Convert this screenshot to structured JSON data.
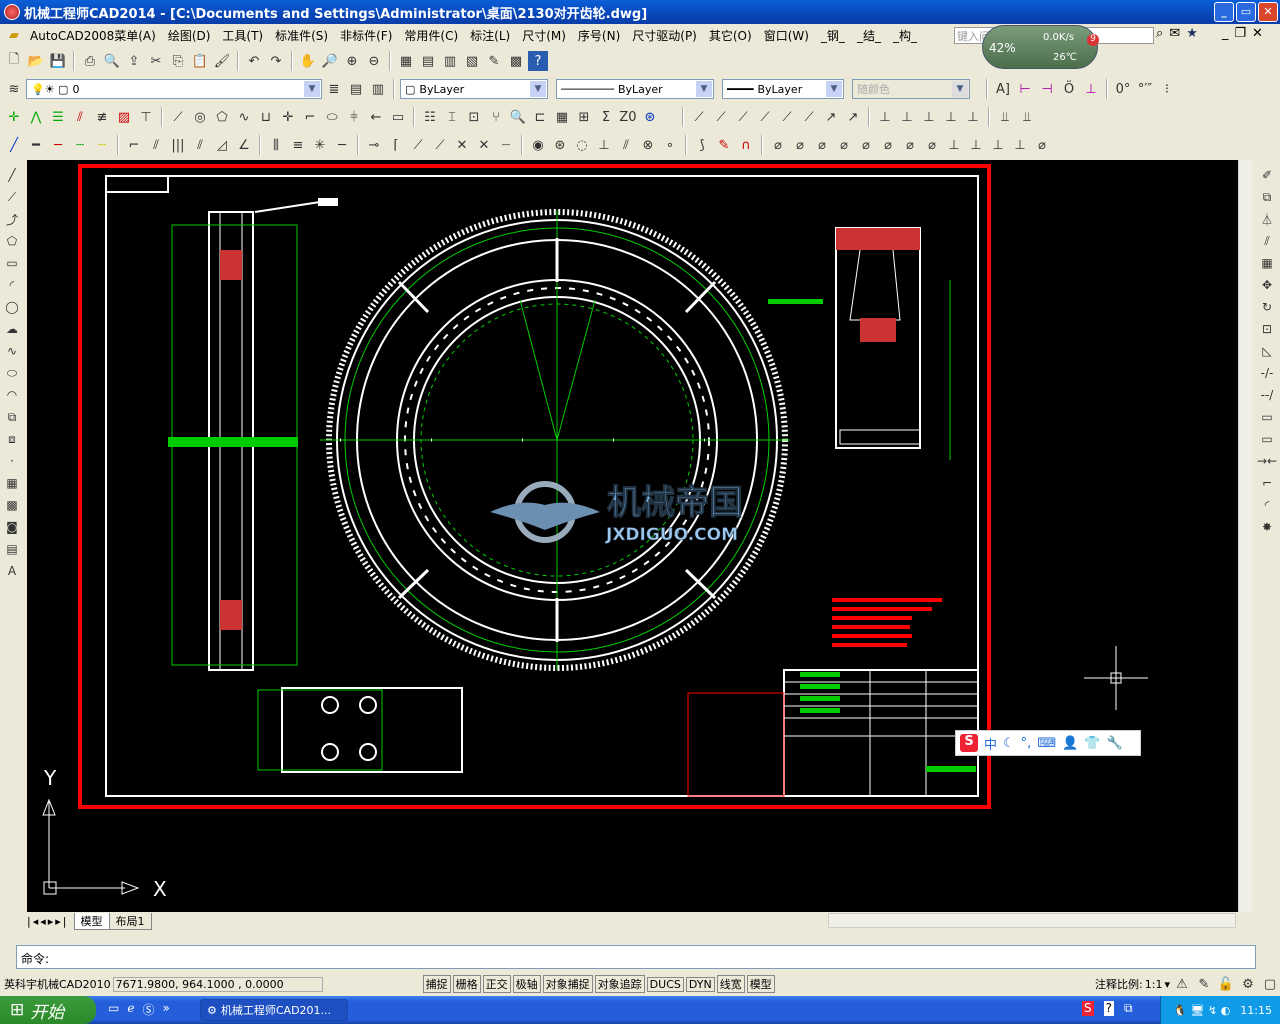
{
  "title": "机械工程师CAD2014 - [C:\\Documents and Settings\\Administrator\\桌面\\2130对开齿轮.dwg]",
  "menu": [
    "AutoCAD2008菜单(A)",
    "绘图(D)",
    "工具(T)",
    "标准件(S)",
    "非标件(F)",
    "常用件(C)",
    "标注(L)",
    "尺寸(M)",
    "序号(N)",
    "尺寸驱动(P)",
    "其它(O)",
    "窗口(W)",
    "_钢_",
    "_结_",
    "_构_"
  ],
  "help_placeholder": "键入问题以获取帮助",
  "widget": {
    "percent": "42%",
    "speed": "0.0K/s",
    "temp": "26℃",
    "badge": "9"
  },
  "layer": {
    "current": "0"
  },
  "properties": {
    "color": "ByLayer",
    "linetype": "ByLayer",
    "lineweight": "ByLayer",
    "plotstyle": "随颜色"
  },
  "drawing": {
    "watermark_cn": "机械帝国",
    "watermark_en": "JXDIGUO.COM",
    "ucs_x": "X",
    "ucs_y": "Y"
  },
  "tabs": [
    "模型",
    "布局1"
  ],
  "command": {
    "prompt": "命令:"
  },
  "status": {
    "app": "英科宇机械CAD2010",
    "coords": "7671.9800, 964.1000 , 0.0000",
    "toggles": [
      "捕捉",
      "栅格",
      "正交",
      "极轴",
      "对象捕捉",
      "对象追踪",
      "DUCS",
      "DYN",
      "线宽",
      "模型"
    ],
    "annotation_scale_label": "注释比例:",
    "annotation_scale": "1:1"
  },
  "ime": {
    "mode": "中"
  },
  "taskbar": {
    "start": "开始",
    "task": "机械工程师CAD201...",
    "clock": "11:15"
  }
}
